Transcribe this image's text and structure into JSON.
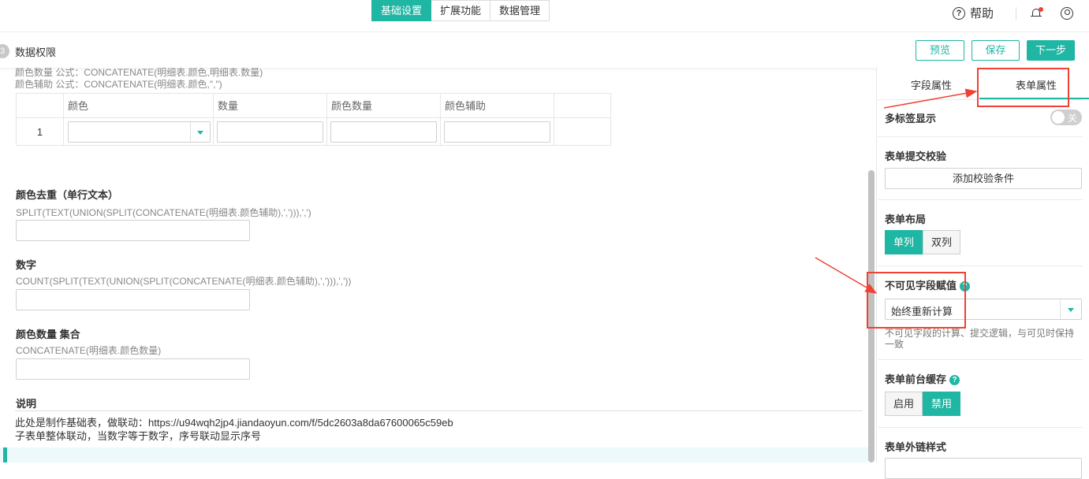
{
  "top_tabs": [
    {
      "label": "基础设置",
      "active": true
    },
    {
      "label": "扩展功能",
      "active": false
    },
    {
      "label": "数据管理",
      "active": false
    }
  ],
  "header": {
    "help_label": "帮助",
    "help_icon": "?"
  },
  "sub_header": {
    "step_number": "3",
    "step_label": "数据权限",
    "preview_label": "预览",
    "save_label": "保存",
    "next_label": "下一步"
  },
  "formulas_top": [
    "颜色数量 公式：CONCATENATE(明细表.颜色,明细表.数量)",
    "颜色辅助 公式：CONCATENATE(明细表.颜色,\",\")"
  ],
  "subtable": {
    "columns": [
      "颜色",
      "数量",
      "颜色数量",
      "颜色辅助"
    ],
    "rows": [
      {
        "index": "1"
      }
    ]
  },
  "fields": [
    {
      "title": "颜色去重（单行文本）",
      "formula": "SPLIT(TEXT(UNION(SPLIT(CONCATENATE(明细表.颜色辅助),','))),',')"
    },
    {
      "title": "数字",
      "formula": "COUNT(SPLIT(TEXT(UNION(SPLIT(CONCATENATE(明细表.颜色辅助),','))),','))"
    },
    {
      "title": "颜色数量 集合",
      "formula": "CONCATENATE(明细表.颜色数量)"
    }
  ],
  "description": {
    "title": "说明",
    "lines": [
      "此处是制作基础表，做联动：https://u94wqh2jp4.jiandaoyun.com/f/5dc2603a8da67600065c59eb",
      "子表单整体联动，当数字等于数字，序号联动显示序号"
    ]
  },
  "right_panel": {
    "tabs": [
      {
        "label": "字段属性",
        "active": false
      },
      {
        "label": "表单属性",
        "active": true
      }
    ],
    "multi_tab": {
      "title": "多标签显示",
      "toggle_text": "关",
      "enabled": false
    },
    "validation": {
      "title": "表单提交校验",
      "button_label": "添加校验条件"
    },
    "layout": {
      "title": "表单布局",
      "options": [
        "单列",
        "双列"
      ],
      "selected": "单列"
    },
    "invisible": {
      "title": "不可见字段赋值",
      "help_icon": "?",
      "value": "始终重新计算",
      "hint": "不可见字段的计算、提交逻辑，与可见时保持一致"
    },
    "cache": {
      "title": "表单前台缓存",
      "help_icon": "?",
      "options": [
        "启用",
        "禁用"
      ],
      "selected": "禁用"
    },
    "external": {
      "title": "表单外链样式"
    }
  },
  "colors": {
    "accent": "#1fb6a4",
    "annotation": "#f04134"
  }
}
